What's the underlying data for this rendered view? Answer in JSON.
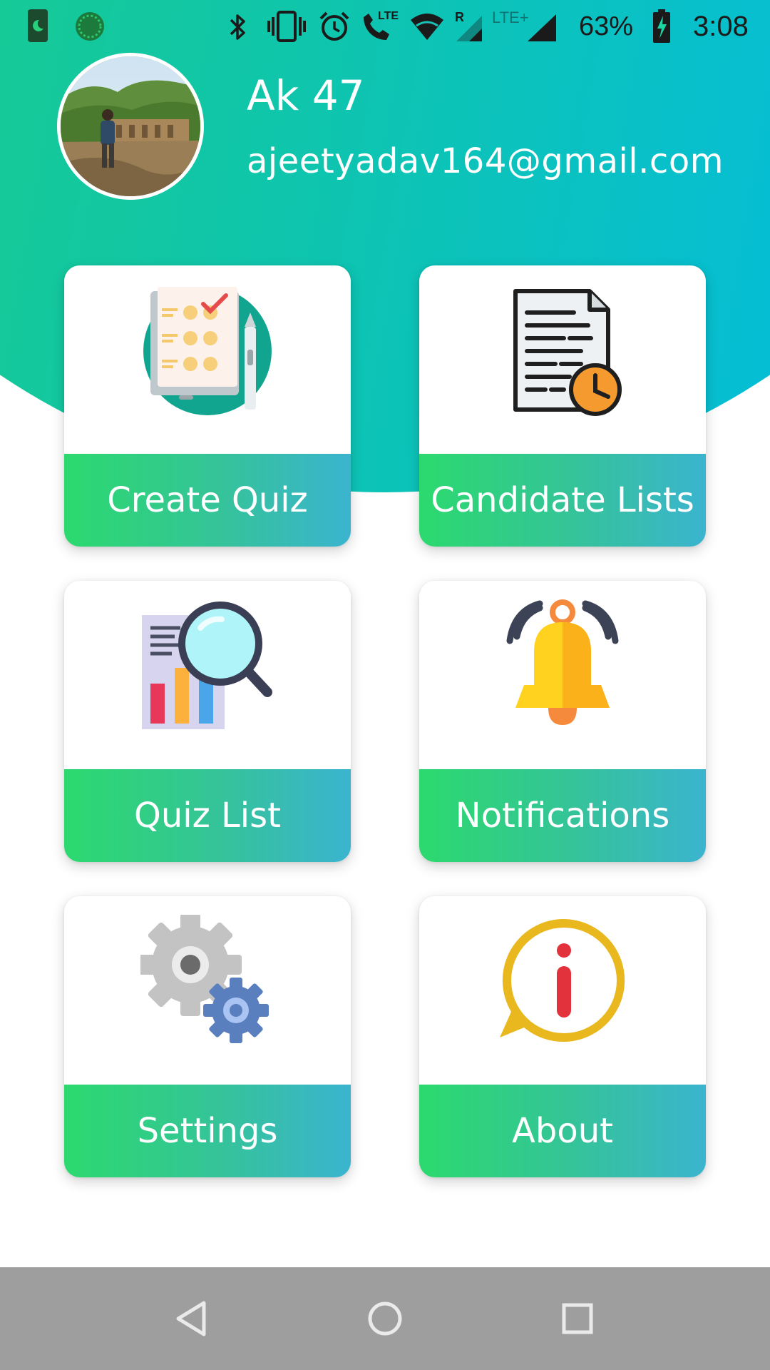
{
  "status_bar": {
    "battery_percent": "63%",
    "time": "3:08",
    "network_labels": [
      "LTE",
      "R",
      "LTE+"
    ],
    "icons": [
      "night-mode-icon",
      "circle-app-icon",
      "bluetooth-icon",
      "vibrate-icon",
      "alarm-icon",
      "volte-call-icon",
      "wifi-icon",
      "signal-icon",
      "battery-charging-icon"
    ]
  },
  "profile": {
    "name": "Ak 47",
    "email": "ajeetyadav164@gmail.com"
  },
  "menu": [
    {
      "label": "Create Quiz",
      "icon": "quiz-checklist-icon"
    },
    {
      "label": "Candidate Lists",
      "icon": "document-clock-icon"
    },
    {
      "label": "Quiz List",
      "icon": "report-search-icon"
    },
    {
      "label": "Notifications",
      "icon": "bell-icon"
    },
    {
      "label": "Settings",
      "icon": "gears-icon"
    },
    {
      "label": "About",
      "icon": "info-bubble-icon"
    }
  ],
  "navigation": {
    "buttons": [
      "back-icon",
      "home-icon",
      "recents-icon"
    ]
  },
  "colors": {
    "header_gradient": [
      "#22d07a",
      "#00b9ee"
    ],
    "label_gradient": [
      "#2cd96e",
      "#3bb4cf"
    ],
    "nav_bar": "#9e9e9e"
  }
}
